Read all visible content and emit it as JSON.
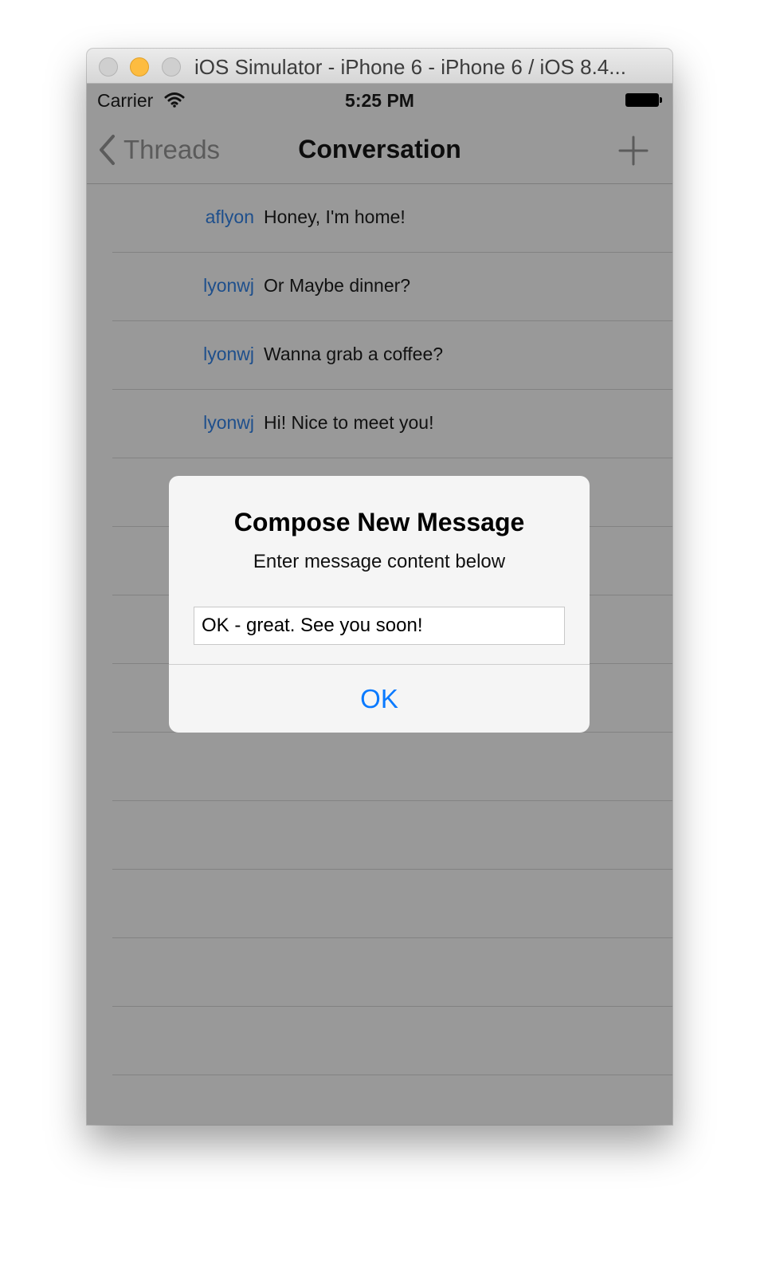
{
  "window": {
    "title": "iOS Simulator - iPhone 6 - iPhone 6 / iOS 8.4..."
  },
  "statusbar": {
    "carrier": "Carrier",
    "time": "5:25 PM"
  },
  "navbar": {
    "back_label": "Threads",
    "title": "Conversation"
  },
  "messages": [
    {
      "user": "aflyon",
      "text": "Honey, I'm home!"
    },
    {
      "user": "lyonwj",
      "text": "Or Maybe dinner?"
    },
    {
      "user": "lyonwj",
      "text": "Wanna grab a coffee?"
    },
    {
      "user": "lyonwj",
      "text": "Hi! Nice to meet you!"
    },
    {
      "user": "",
      "text": ""
    },
    {
      "user": "",
      "text": ""
    },
    {
      "user": "",
      "text": ""
    },
    {
      "user": "",
      "text": ""
    },
    {
      "user": "",
      "text": ""
    },
    {
      "user": "",
      "text": ""
    },
    {
      "user": "",
      "text": ""
    },
    {
      "user": "",
      "text": ""
    },
    {
      "user": "",
      "text": ""
    }
  ],
  "alert": {
    "title": "Compose New Message",
    "message": "Enter message content below",
    "input_value": "OK - great. See you soon!",
    "ok_label": "OK"
  },
  "colors": {
    "dimmed_background": "#999999",
    "username": "#1e4f8c",
    "accent": "#0a7aff",
    "minimize_button": "#fdbc40"
  }
}
